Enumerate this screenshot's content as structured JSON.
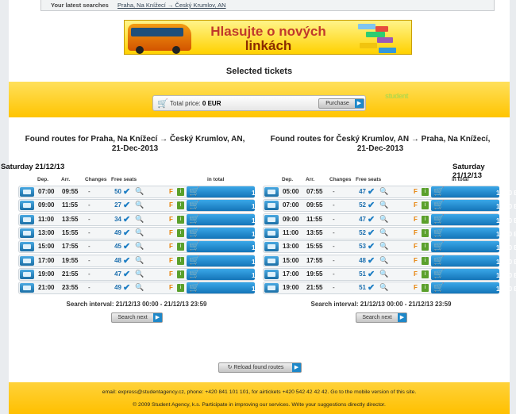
{
  "latest": {
    "label": "Your latest searches",
    "link": "Praha, Na Knížecí → Český Krumlov, AN"
  },
  "banner": {
    "line1_a": "Hlasujte",
    "line1_b": "o nových",
    "line2": "linkách"
  },
  "selected_title": "Selected tickets",
  "totals": {
    "label": "Total price:",
    "value": "0 EUR",
    "purchase": "Purchase",
    "logo": "student"
  },
  "left": {
    "title": "Found routes for Praha, Na Knížecí → Český Krumlov, AN, 21-Dec-2013",
    "date": "Saturday 21/12/13",
    "headers": {
      "dep": "Dep.",
      "arr": "Arr.",
      "changes": "Changes",
      "seats": "Free seats",
      "total": "in total"
    },
    "rows": [
      {
        "dep": "07:00",
        "arr": "09:55",
        "changes": "-",
        "seats": "50",
        "price": "13.50 EUR"
      },
      {
        "dep": "09:00",
        "arr": "11:55",
        "changes": "-",
        "seats": "27",
        "price": "13.50 EUR"
      },
      {
        "dep": "11:00",
        "arr": "13:55",
        "changes": "-",
        "seats": "34",
        "price": "13.50 EUR"
      },
      {
        "dep": "13:00",
        "arr": "15:55",
        "changes": "-",
        "seats": "49",
        "price": "13.50 EUR"
      },
      {
        "dep": "15:00",
        "arr": "17:55",
        "changes": "-",
        "seats": "45",
        "price": "13.50 EUR"
      },
      {
        "dep": "17:00",
        "arr": "19:55",
        "changes": "-",
        "seats": "48",
        "price": "13.50 EUR"
      },
      {
        "dep": "19:00",
        "arr": "21:55",
        "changes": "-",
        "seats": "47",
        "price": "13.50 EUR"
      },
      {
        "dep": "21:00",
        "arr": "23:55",
        "changes": "-",
        "seats": "49",
        "price": "13.50 EUR"
      }
    ],
    "interval": "Search interval: 21/12/13 00:00 - 21/12/13 23:59",
    "next": "Search next"
  },
  "right": {
    "title": "Found routes for Český Krumlov, AN → Praha, Na Knížecí, 21-Dec-2013",
    "date": "Saturday 21/12/13",
    "headers": {
      "dep": "Dep.",
      "arr": "Arr.",
      "changes": "Changes",
      "seats": "Free seats",
      "total": "in total"
    },
    "rows": [
      {
        "dep": "05:00",
        "arr": "07:55",
        "changes": "-",
        "seats": "47",
        "price": "13.50 EUR"
      },
      {
        "dep": "07:00",
        "arr": "09:55",
        "changes": "-",
        "seats": "52",
        "price": "13.50 EUR"
      },
      {
        "dep": "09:00",
        "arr": "11:55",
        "changes": "-",
        "seats": "47",
        "price": "13.50 EUR"
      },
      {
        "dep": "11:00",
        "arr": "13:55",
        "changes": "-",
        "seats": "52",
        "price": "13.50 EUR"
      },
      {
        "dep": "13:00",
        "arr": "15:55",
        "changes": "-",
        "seats": "53",
        "price": "13.50 EUR"
      },
      {
        "dep": "15:00",
        "arr": "17:55",
        "changes": "-",
        "seats": "48",
        "price": "13.50 EUR"
      },
      {
        "dep": "17:00",
        "arr": "19:55",
        "changes": "-",
        "seats": "51",
        "price": "13.50 EUR"
      },
      {
        "dep": "19:00",
        "arr": "21:55",
        "changes": "-",
        "seats": "51",
        "price": "13.50 EUR"
      }
    ],
    "interval": "Search interval: 21/12/13 00:00 - 21/12/13 23:59",
    "next": "Search next"
  },
  "reload": "Reload found routes",
  "footer": {
    "line1": "email: express@studentagency.cz, phone: +420 841 101 101, for airtickets +420 542 42 42 42. Go to the mobile version of this site.",
    "line2": "© 2009 Student Agency, k.s.     Participate in improving our services. Write your suggestions directly director."
  },
  "icons": {
    "cart": "cart-icon",
    "bus": "bus-icon",
    "check": "check-icon",
    "magnifier": "magnifier-icon",
    "fare": "fare-icon",
    "info": "info-icon",
    "arrow": "arrow-right-icon"
  },
  "colors": {
    "accent_blue": "#1d7ec4",
    "orange": "#ffc400"
  }
}
